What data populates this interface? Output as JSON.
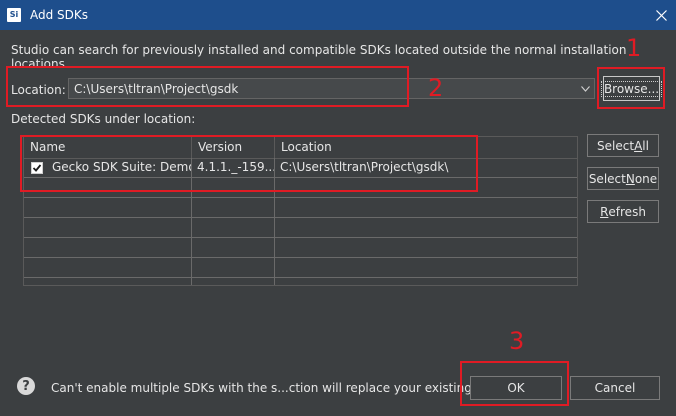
{
  "window": {
    "app_icon_text": "Si",
    "title": "Add SDKs",
    "close_icon": "close-icon"
  },
  "description": "Studio can search for previously installed and compatible SDKs located outside the normal installation locations.",
  "location": {
    "label": "Location:",
    "value": "C:\\Users\\tltran\\Project\\gsdk",
    "browse_label": "Browse..."
  },
  "detected_label": "Detected SDKs under location:",
  "table": {
    "columns": [
      "Name",
      "Version",
      "Location"
    ],
    "rows": [
      {
        "checked": true,
        "name": "Gecko SDK Suite: Demo...",
        "version": "4.1.1._-159....",
        "location": "C:\\Users\\tltran\\Project\\gsdk\\"
      }
    ]
  },
  "side_buttons": {
    "select_all_pre": "Select ",
    "select_all_key": "A",
    "select_all_post": "ll",
    "select_none_pre": "Select ",
    "select_none_key": "N",
    "select_none_post": "one",
    "refresh_key": "R",
    "refresh_post": "efresh"
  },
  "footer": {
    "help_icon": "?",
    "message": "Can't enable multiple SDKs with the s...ction will replace your existing one.",
    "ok_label": "OK",
    "cancel_label": "Cancel"
  },
  "annotations": {
    "color": "#e01b24",
    "numbers": [
      "1",
      "2",
      "3"
    ]
  },
  "colors": {
    "titlebar": "#1e4e8c",
    "dialog_bg": "#3c3f41"
  }
}
